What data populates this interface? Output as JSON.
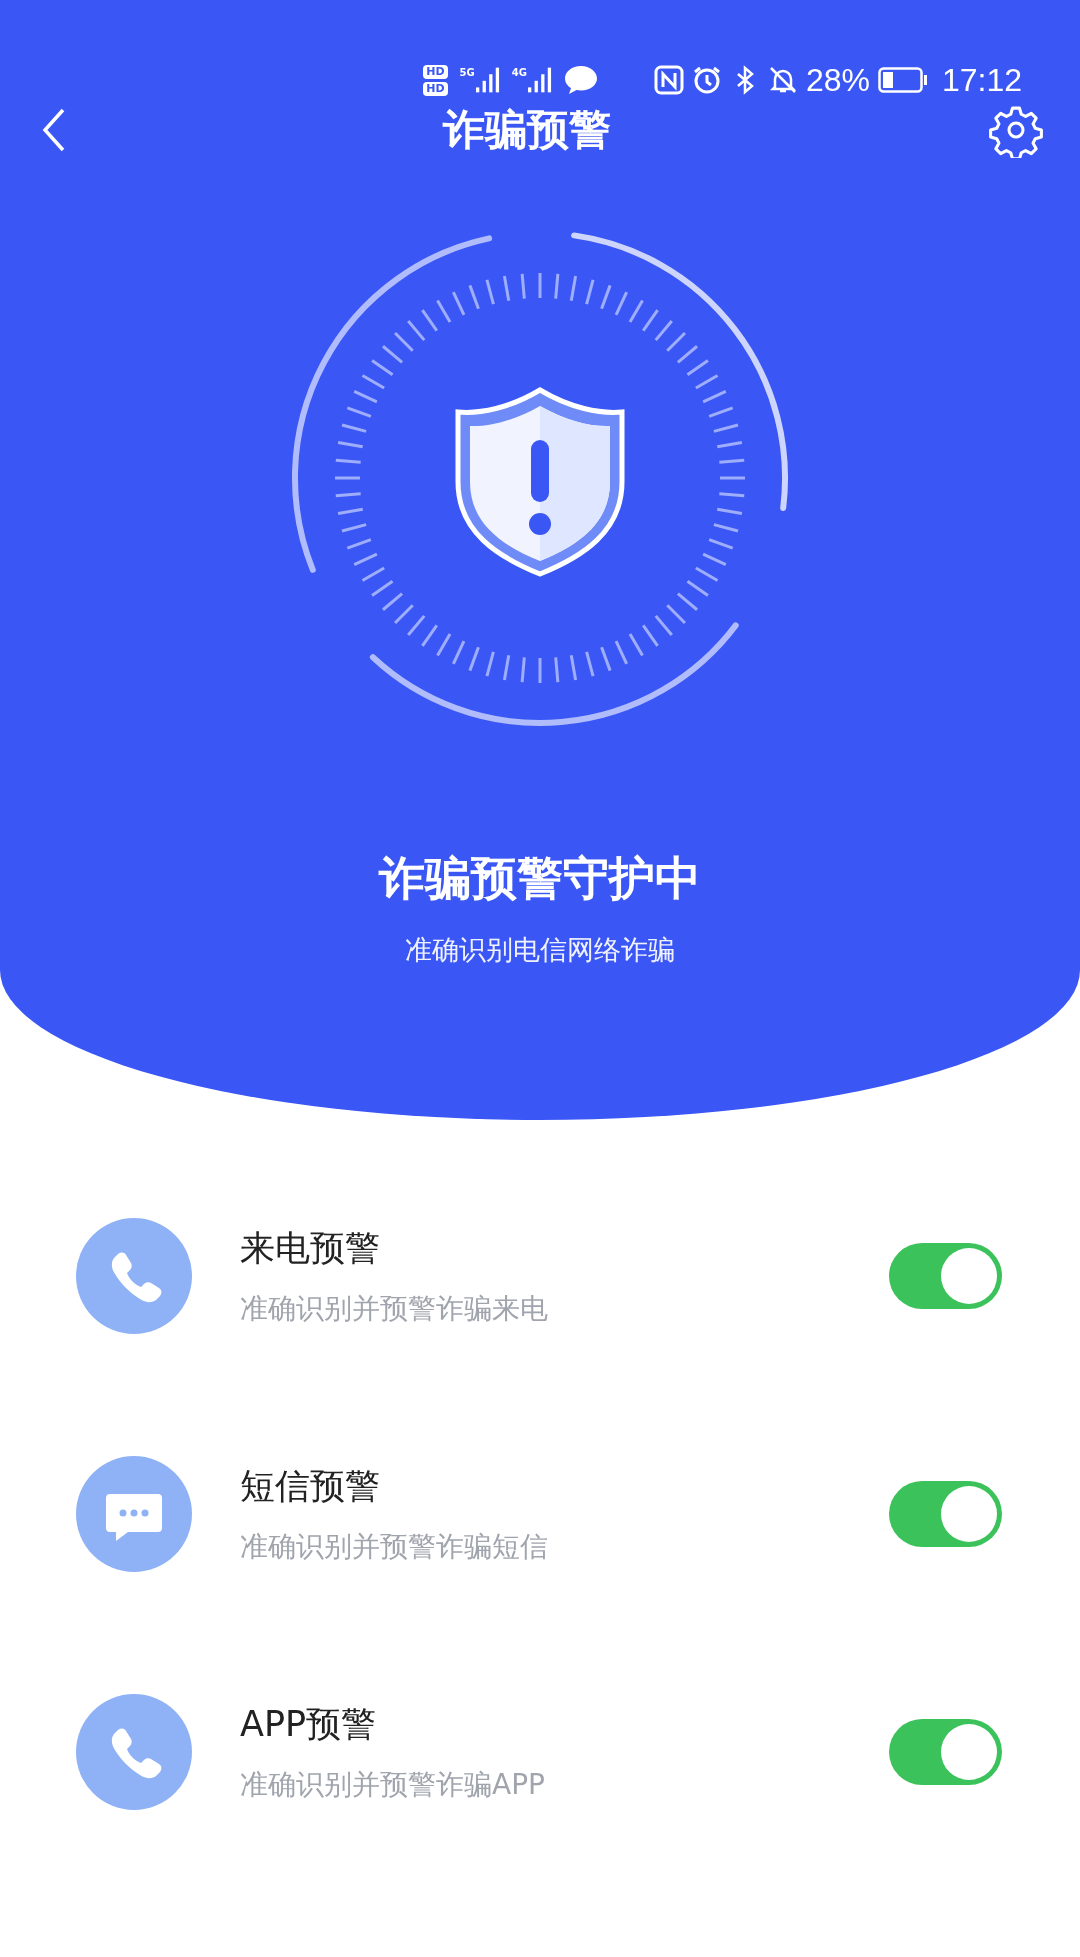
{
  "status_bar": {
    "sim_badges": [
      "HD",
      "HD"
    ],
    "networks": [
      "5G",
      "4G"
    ],
    "battery": "28%",
    "time": "17:12"
  },
  "header": {
    "title": "诈骗预警"
  },
  "hero": {
    "title": "诈骗预警守护中",
    "subtitle": "准确识别电信网络诈骗"
  },
  "features": [
    {
      "kind": "phone",
      "title": "来电预警",
      "description": "准确识别并预警诈骗来电",
      "on": true
    },
    {
      "kind": "message",
      "title": "短信预警",
      "description": "准确识别并预警诈骗短信",
      "on": true
    },
    {
      "kind": "phone",
      "title": "APP预警",
      "description": "准确识别并预警诈骗APP",
      "on": true
    }
  ]
}
